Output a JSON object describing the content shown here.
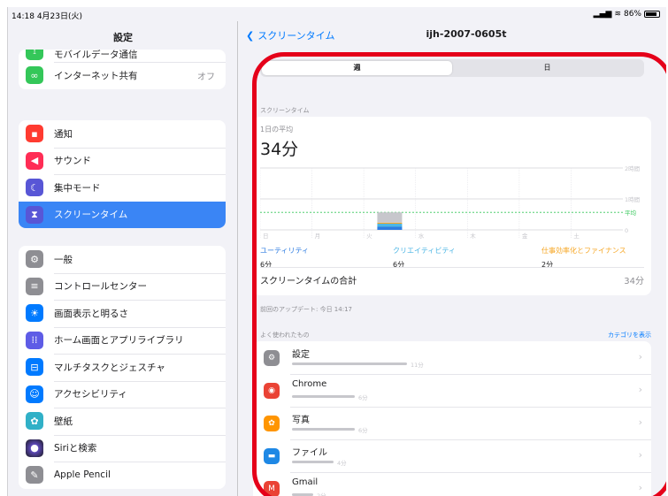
{
  "status": {
    "time": "14:18",
    "date": "4月23日(火)",
    "battery": "86%"
  },
  "sidebar": {
    "title": "設定",
    "group1": [
      {
        "label": "モバイルデータ通信",
        "icon": "antenna-icon",
        "color": "#34c759"
      },
      {
        "label": "インターネット共有",
        "value": "オフ",
        "icon": "link-icon",
        "color": "#34c759"
      }
    ],
    "group2": [
      {
        "label": "通知",
        "icon": "bell-icon",
        "color": "#ff3b30"
      },
      {
        "label": "サウンド",
        "icon": "speaker-icon",
        "color": "#ff2d55"
      },
      {
        "label": "集中モード",
        "icon": "moon-icon",
        "color": "#5856d6"
      },
      {
        "label": "スクリーンタイム",
        "icon": "hourglass-icon",
        "color": "#5856d6"
      }
    ],
    "group3": [
      {
        "label": "一般",
        "icon": "gear-icon",
        "color": "#8e8e93"
      },
      {
        "label": "コントロールセンター",
        "icon": "toggles-icon",
        "color": "#8e8e93"
      },
      {
        "label": "画面表示と明るさ",
        "icon": "sun-icon",
        "color": "#007aff"
      },
      {
        "label": "ホーム画面とアプリライブラリ",
        "icon": "grid-icon",
        "color": "#5e5ce6"
      },
      {
        "label": "マルチタスクとジェスチャ",
        "icon": "multitask-icon",
        "color": "#007aff"
      },
      {
        "label": "アクセシビリティ",
        "icon": "accessibility-icon",
        "color": "#007aff"
      },
      {
        "label": "壁紙",
        "icon": "flower-icon",
        "color": "#30b0c7"
      },
      {
        "label": "Siriと検索",
        "icon": "siri-icon",
        "color": "#1c1c1e"
      },
      {
        "label": "Apple Pencil",
        "icon": "pencil-icon",
        "color": "#8e8e93"
      }
    ]
  },
  "detail": {
    "back": "スクリーンタイム",
    "device": "ijh-2007-0605t",
    "segments": [
      "週",
      "日"
    ],
    "section": "スクリーンタイム",
    "avg_label": "1日の平均",
    "avg_value": "34分",
    "total_label": "スクリーンタイムの合計",
    "total_value": "34分",
    "updated": "前回のアップデート: 今日 14:17",
    "frequent": "よく使われたもの",
    "show_categories": "カテゴリを表示"
  },
  "chart_data": {
    "type": "bar",
    "categories": [
      "日",
      "月",
      "火",
      "水",
      "木",
      "金",
      "土"
    ],
    "y_tick_labels": [
      "2時間",
      "1時間",
      "0"
    ],
    "average_label": "平均",
    "average_minutes": 34,
    "series": [
      {
        "name": "ユーティリティ",
        "color": "#2f7de1",
        "values": [
          0,
          0,
          6,
          0,
          0,
          0,
          0
        ]
      },
      {
        "name": "クリエイティビティ",
        "color": "#4db6e5",
        "values": [
          0,
          0,
          6,
          0,
          0,
          0,
          0
        ]
      },
      {
        "name": "仕事効率化とファイナンス",
        "color": "#f6a623",
        "values": [
          0,
          0,
          2,
          0,
          0,
          0,
          0
        ]
      },
      {
        "color": "#c7c7cc",
        "values": [
          0,
          0,
          20,
          0,
          0,
          0,
          0
        ]
      }
    ],
    "legend": [
      {
        "name": "ユーティリティ",
        "value": "6分",
        "color": "#2f7de1"
      },
      {
        "name": "クリエイティビティ",
        "value": "6分",
        "color": "#4db6e5"
      },
      {
        "name": "仕事効率化とファイナンス",
        "value": "2分",
        "color": "#f6a623"
      }
    ],
    "ylim": [
      0,
      120
    ]
  },
  "apps": [
    {
      "name": "設定",
      "time": "11分",
      "minutes": 11,
      "icon": "gear-icon",
      "color": "#8e8e93"
    },
    {
      "name": "Chrome",
      "time": "6分",
      "minutes": 6,
      "icon": "chrome-icon",
      "color": "#ea4335"
    },
    {
      "name": "写真",
      "time": "6分",
      "minutes": 6,
      "icon": "photos-icon",
      "color": "#ff9500"
    },
    {
      "name": "ファイル",
      "time": "4分",
      "minutes": 4,
      "icon": "folder-icon",
      "color": "#1e88e5"
    },
    {
      "name": "Gmail",
      "time": "2分",
      "minutes": 2,
      "icon": "mail-icon",
      "color": "#ea4335"
    }
  ]
}
